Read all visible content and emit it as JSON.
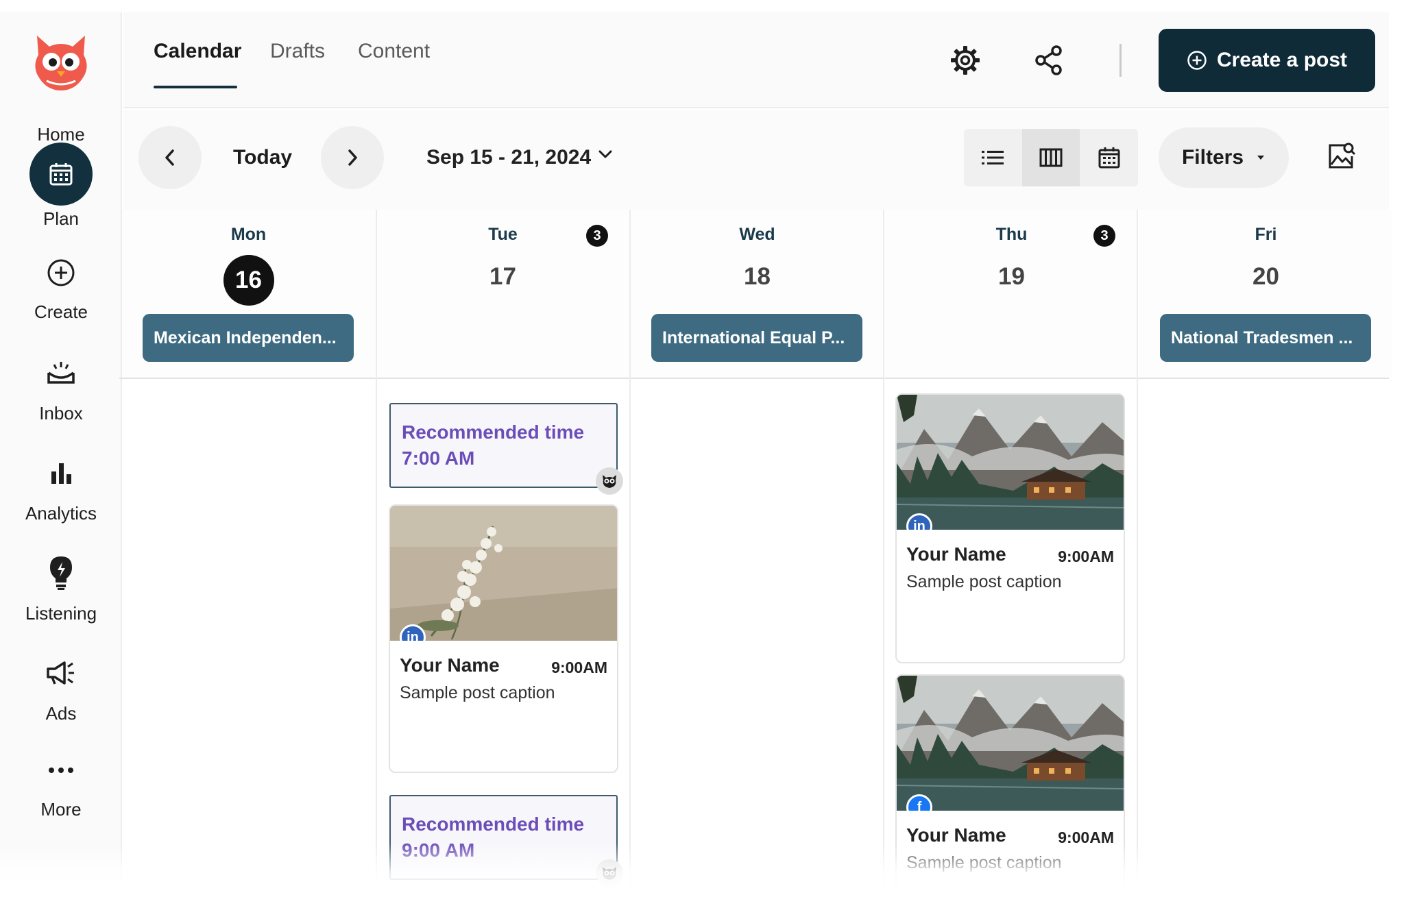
{
  "sidebar": {
    "items": [
      {
        "label": "Home",
        "icon": "owl-logo"
      },
      {
        "label": "Plan",
        "icon": "calendar-icon"
      },
      {
        "label": "Create",
        "icon": "plus-circle-icon"
      },
      {
        "label": "Inbox",
        "icon": "inbox-icon"
      },
      {
        "label": "Analytics",
        "icon": "bar-chart-icon"
      },
      {
        "label": "Listening",
        "icon": "lightbulb-icon"
      },
      {
        "label": "Ads",
        "icon": "megaphone-icon"
      },
      {
        "label": "More",
        "icon": "ellipsis-icon"
      }
    ]
  },
  "header": {
    "tabs": [
      {
        "label": "Calendar",
        "active": true
      },
      {
        "label": "Drafts",
        "active": false
      },
      {
        "label": "Content",
        "active": false
      }
    ],
    "create_button": "Create a post"
  },
  "toolbar": {
    "today_label": "Today",
    "date_range": "Sep 15 - 21, 2024",
    "filters_label": "Filters",
    "active_view": "week"
  },
  "calendar": {
    "days": [
      {
        "name": "Mon",
        "date": "16",
        "is_today": true,
        "count": null,
        "holiday": "Mexican Independen..."
      },
      {
        "name": "Tue",
        "date": "17",
        "is_today": false,
        "count": "3",
        "holiday": null
      },
      {
        "name": "Wed",
        "date": "18",
        "is_today": false,
        "count": null,
        "holiday": "International Equal P..."
      },
      {
        "name": "Thu",
        "date": "19",
        "is_today": false,
        "count": "3",
        "holiday": null
      },
      {
        "name": "Fri",
        "date": "20",
        "is_today": false,
        "count": null,
        "holiday": "National Tradesmen ..."
      }
    ],
    "recommended": [
      {
        "title": "Recommended time",
        "time": "7:00 AM"
      },
      {
        "title": "Recommended time",
        "time": "9:00 AM"
      }
    ],
    "posts": [
      {
        "name": "Your Name",
        "time": "9:00AM",
        "caption": "Sample post caption",
        "network": "linkedin",
        "network_badge": "in",
        "image": "flowers"
      },
      {
        "name": "Your Name",
        "time": "9:00AM",
        "caption": "Sample post caption",
        "network": "linkedin",
        "network_badge": "in",
        "image": "mountain-lake"
      },
      {
        "name": "Your Name",
        "time": "9:00AM",
        "caption": "Sample post caption",
        "network": "facebook",
        "network_badge": "f",
        "image": "mountain-lake"
      }
    ]
  },
  "colors": {
    "brand_dark": "#0f2b38",
    "holiday_pill": "#3e6b81",
    "recommended_text": "#6b4db8",
    "linkedin": "#2e64bc",
    "facebook": "#1877f2",
    "owl_red": "#ef5a4c"
  }
}
